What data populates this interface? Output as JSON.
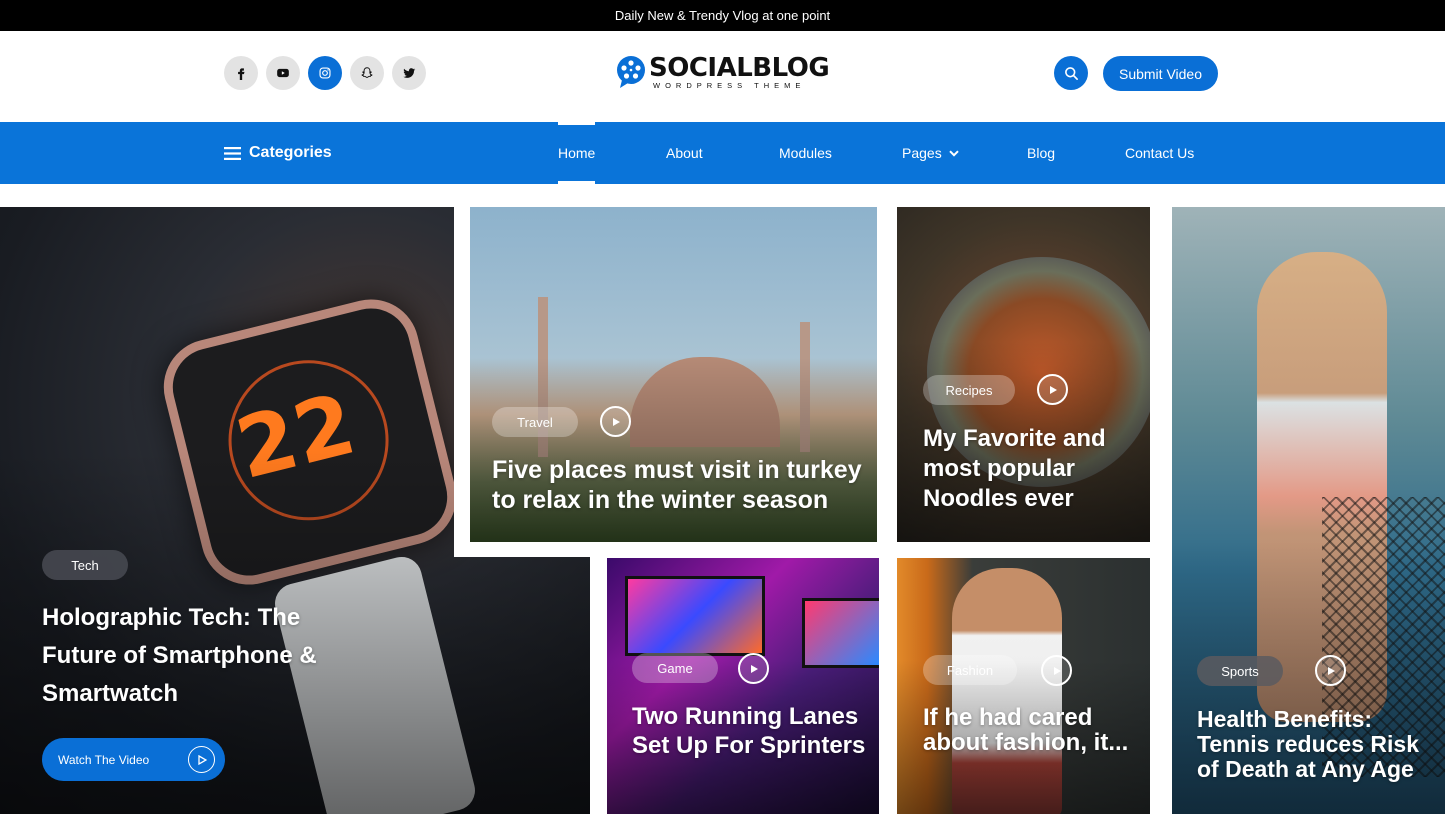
{
  "topbar": {
    "text": "Daily New & Trendy Vlog at one point"
  },
  "header": {
    "logo": {
      "name": "SOCIALBLOG",
      "tagline": "WORDPRESS THEME"
    },
    "socials": [
      {
        "icon": "facebook-icon"
      },
      {
        "icon": "youtube-icon"
      },
      {
        "icon": "instagram-icon"
      },
      {
        "icon": "snapchat-icon"
      },
      {
        "icon": "twitter-icon"
      }
    ],
    "search_icon": "search-icon",
    "submit_label": "Submit Video"
  },
  "nav": {
    "categories_label": "Categories",
    "items": [
      {
        "label": "Home",
        "active": true
      },
      {
        "label": "About"
      },
      {
        "label": "Modules"
      },
      {
        "label": "Pages",
        "has_dropdown": true
      },
      {
        "label": "Blog"
      },
      {
        "label": "Contact Us"
      }
    ]
  },
  "posts": {
    "tech": {
      "tag": "Tech",
      "title": "Holographic Tech: The Future of Smartphone & Smartwatch",
      "watch_label": "Watch The Video"
    },
    "travel": {
      "tag": "Travel",
      "title": "Five places must visit in turkey to relax in the winter season"
    },
    "recipes": {
      "tag": "Recipes",
      "title": "My Favorite and most popular Noodles ever"
    },
    "sports": {
      "tag": "Sports",
      "title": "Health Benefits: Tennis reduces Risk of Death at Any Age"
    },
    "game": {
      "tag": "Game",
      "title": "Two Running Lanes Set Up For Sprinters"
    },
    "fashion": {
      "tag": "Fashion",
      "title": "If he had cared about fashion, it..."
    }
  },
  "colors": {
    "brand_blue": "#0a74d9",
    "topbar": "#000000"
  }
}
